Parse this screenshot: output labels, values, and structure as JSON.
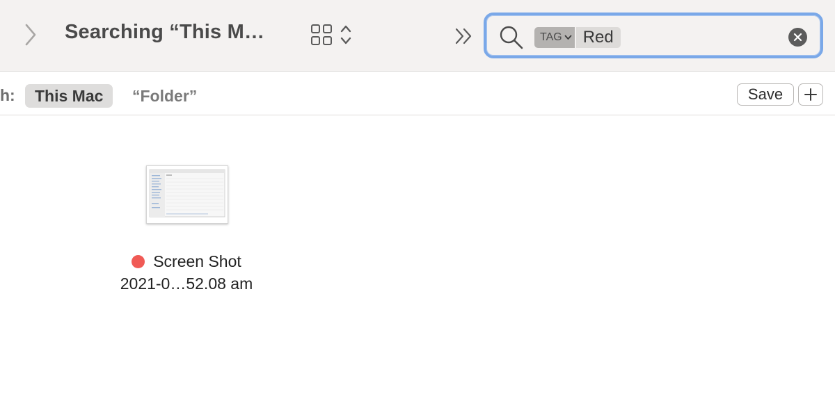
{
  "toolbar": {
    "title": "Searching “This M…",
    "forward_icon": "chevron-right-icon",
    "view_icon": "grid-icon",
    "view_menu_icon": "up-down-chevron-icon",
    "overflow_icon": "double-chevron-right-icon"
  },
  "search": {
    "icon": "magnifier-icon",
    "token_type": "TAG",
    "token_value": "Red",
    "clear_icon": "clear-x-icon",
    "focus_color": "#7aa8e8"
  },
  "scopebar": {
    "label": "h:",
    "scopes": [
      {
        "label": "This Mac",
        "selected": true
      },
      {
        "label": "“Folder”",
        "selected": false
      }
    ],
    "save_label": "Save",
    "add_icon": "plus-icon"
  },
  "files": [
    {
      "name_line1": "Screen Shot",
      "name_line2": "2021-0…52.08 am",
      "tag_color": "#f05a55"
    }
  ]
}
